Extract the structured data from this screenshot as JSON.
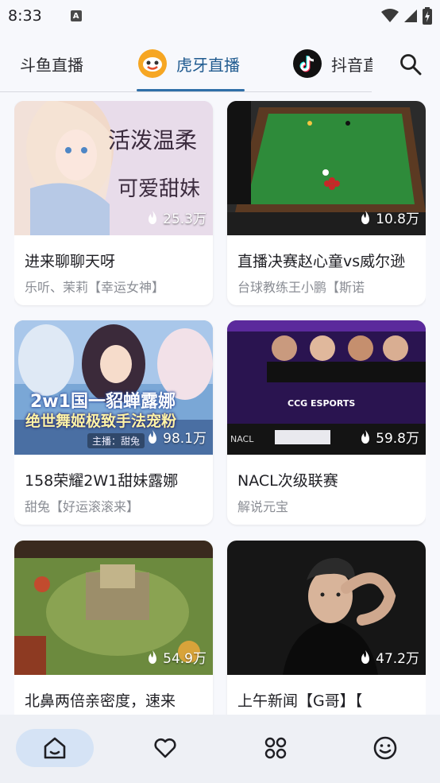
{
  "status_bar": {
    "time": "8:33",
    "notification_glyph": "A"
  },
  "tabs": [
    {
      "label": "斗鱼直播",
      "icon": ""
    },
    {
      "label": "虎牙直播",
      "icon": "huya-logo-icon",
      "selected": true
    },
    {
      "label": "抖音直播",
      "icon": "douyin-logo-icon"
    }
  ],
  "search_icon": "search-icon",
  "accent_color": "#2f6fa8",
  "rooms": [
    {
      "title": "进来聊聊天呀",
      "subtitle": "乐听、茉莉【幸运女神】",
      "heat": "25.3万",
      "thumb_text_1": "活泼温柔",
      "thumb_text_2": "可爱甜妹"
    },
    {
      "title": "直播决赛赵心童vs威尔逊",
      "subtitle": "台球教练王小鹏【斯诺",
      "heat": "10.8万"
    },
    {
      "title": "158荣耀2W1甜妹露娜",
      "subtitle": "甜兔【好运滚滚来】",
      "heat": "98.1万",
      "thumb_text_1": "2w1国一貂蝉露娜",
      "thumb_text_2": "绝世舞姬极致手法宠粉",
      "thumb_text_3": "主播：甜兔"
    },
    {
      "title": "NACL次级联赛",
      "subtitle": "解说元宝",
      "heat": "59.8万",
      "thumb_text_1": "CCG ESPORTS",
      "thumb_text_2": "NACL"
    },
    {
      "title": "北鼻两倍亲密度，速来",
      "subtitle": "",
      "heat": "54.9万"
    },
    {
      "title": "上午新闻【G哥】【",
      "subtitle": "",
      "heat": "47.2万"
    }
  ],
  "bottom_nav": [
    {
      "icon": "home-icon",
      "active": true
    },
    {
      "icon": "heart-icon"
    },
    {
      "icon": "category-grid-icon"
    },
    {
      "icon": "smiley-face-icon"
    }
  ]
}
